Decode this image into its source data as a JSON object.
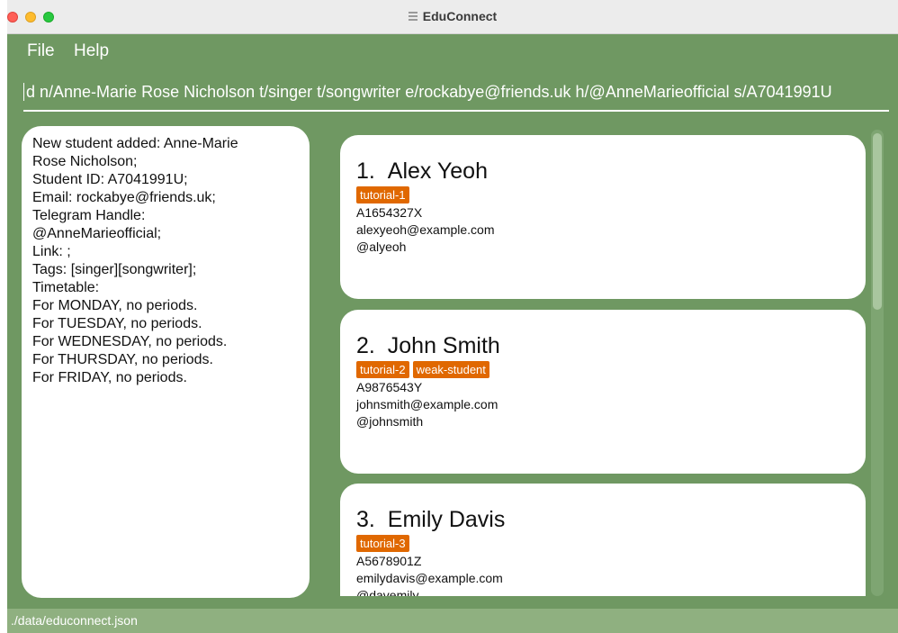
{
  "window": {
    "title": "EduConnect"
  },
  "menu": {
    "file": "File",
    "help": "Help"
  },
  "command": {
    "value": "d n/Anne-Marie Rose Nicholson t/singer t/songwriter e/rockabye@friends.uk h/@AnneMarieofficial s/A7041991U"
  },
  "result": {
    "lines": [
      "New student added: Anne-Marie",
      "Rose Nicholson;",
      "Student ID: A7041991U;",
      "Email: rockabye@friends.uk;",
      "Telegram Handle:",
      "@AnneMarieofficial;",
      "Link: ;",
      "Tags: [singer][songwriter];",
      "Timetable:",
      "For MONDAY, no periods.",
      "",
      "For TUESDAY, no periods.",
      "",
      "For WEDNESDAY, no periods.",
      "",
      "For THURSDAY, no periods.",
      "",
      "For FRIDAY, no periods."
    ]
  },
  "students": [
    {
      "index": "1.",
      "name": "Alex Yeoh",
      "tags": [
        "tutorial-1"
      ],
      "id": "A1654327X",
      "email": "alexyeoh@example.com",
      "handle": "@alyeoh"
    },
    {
      "index": "2.",
      "name": "John Smith",
      "tags": [
        "tutorial-2",
        "weak-student"
      ],
      "id": "A9876543Y",
      "email": "johnsmith@example.com",
      "handle": "@johnsmith"
    },
    {
      "index": "3.",
      "name": "Emily Davis",
      "tags": [
        "tutorial-3"
      ],
      "id": "A5678901Z",
      "email": "emilydavis@example.com",
      "handle": "@davemily"
    }
  ],
  "status": {
    "path": "./data/educonnect.json"
  },
  "colors": {
    "background": "#6f9862",
    "tag": "#e06800",
    "statusbar": "#8fb080"
  }
}
